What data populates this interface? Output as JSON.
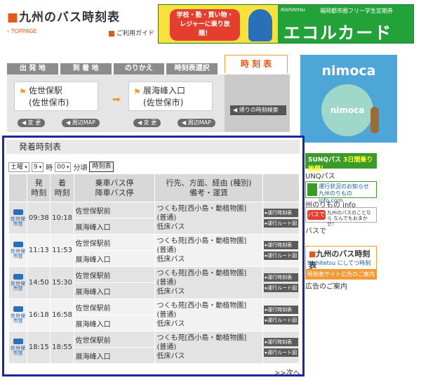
{
  "header": {
    "logo_mark": "■",
    "logo_text": "九州のバス時刻表",
    "toppage": "‹ TOPPAGE",
    "guide": "ご利用ガイド"
  },
  "ad_top": {
    "left_text": "学校・塾・買い物・レジャーに乗り放題！",
    "brand": "Nishitetsu",
    "small": "福岡都市圏フリー学生定期券",
    "big": "エコルカード"
  },
  "tabs": [
    "出 発 地",
    "到 着 地",
    "のりかえ",
    "時刻表選択"
  ],
  "active_tab": "時 刻 表",
  "search": {
    "from": "佐世保駅\n(佐世保市)",
    "to": "展海峰入口\n(佐世保市)",
    "change1": "◀ 変 更",
    "map1": "◀ 周辺MAP",
    "change2": "◀ 変 更",
    "map2": "◀ 周辺MAP",
    "return_btn": "◀ 帰りの時刻検索"
  },
  "nimoca": {
    "title": "nimoca",
    "card": "nimoca"
  },
  "side": {
    "b1": "SUNQパス",
    "b1_hl": "3日間乗り放題！",
    "t1": "UNQパス",
    "b2": "運行状況のお知らせ 九州のりもの info.com",
    "t2": "州のりもの info",
    "b3_icon": "バスで",
    "b3": "九州のバスのことなら なんでもおまかせ！",
    "t3": "バスで",
    "b4_mark": "■",
    "b4_title": "九州のバス時刻表",
    "b4_l2": "Nishitetsu にしてつ時刻表",
    "b4_l3": "時刻表サイト広告のご案内",
    "t4": "広告のご案内"
  },
  "timetable": {
    "title": "発着時刻表",
    "day": "土曜",
    "hour": "9",
    "hour_label": "時",
    "minute": "00",
    "minute_label": "分頃",
    "show": "時刻表",
    "headers": {
      "dep": "発\n時刻",
      "arr": "着\n時刻",
      "stops": "乗車バス停\n降車バス停",
      "dest": "行先、方面、経由 (種別)\n備考・運賃"
    },
    "rows": [
      {
        "op": "佐世保市営",
        "dep": "09:38",
        "arr": "10:18",
        "from": "佐世保駅前",
        "to": "展海峰入口",
        "dest": "つくも苑[西小島・動植物園]",
        "type": "(普通)",
        "note": "低床バス",
        "btn1": "▸運行時刻表",
        "btn2": "▸運行ルート図"
      },
      {
        "op": "佐世保市営",
        "dep": "11:13",
        "arr": "11:53",
        "from": "佐世保駅前",
        "to": "展海峰入口",
        "dest": "つくも苑[西小島・動植物園]",
        "type": "(普通)",
        "note": "低床バス",
        "btn1": "▸運行時刻表",
        "btn2": "▸運行ルート図"
      },
      {
        "op": "佐世保市営",
        "dep": "14:50",
        "arr": "15:30",
        "from": "佐世保駅前",
        "to": "展海峰入口",
        "dest": "つくも苑[西小島・動植物園]",
        "type": "(普通)",
        "note": "低床バス",
        "btn1": "▸運行時刻表",
        "btn2": "▸運行ルート図"
      },
      {
        "op": "佐世保市営",
        "dep": "16:18",
        "arr": "16:58",
        "from": "佐世保駅前",
        "to": "展海峰入口",
        "dest": "つくも苑[西小島・動植物園]",
        "type": "(普通)",
        "note": "低床バス",
        "btn1": "▸運行時刻表",
        "btn2": "▸運行ルート図"
      },
      {
        "op": "佐世保市営",
        "dep": "18:15",
        "arr": "18:55",
        "from": "佐世保駅前",
        "to": "展海峰入口",
        "dest": "つくも苑[西小島・動植物園]",
        "type": "(普通)",
        "note": "低床バス",
        "btn1": "▸運行時刻表",
        "btn2": "▸運行ルート図"
      }
    ],
    "next": ">>次へ"
  },
  "colors": {
    "accent": "#e05a1a",
    "frame": "#1a2a9a",
    "nimoca": "#4ea6d8",
    "ad_green": "#23a23a"
  }
}
